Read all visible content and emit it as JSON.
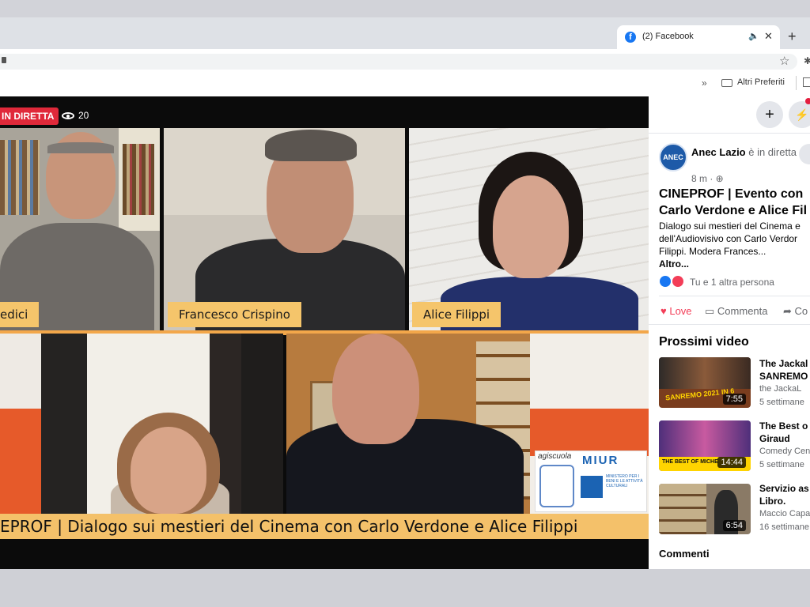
{
  "browser": {
    "tab_title": "(2) Facebook",
    "tab_icon": "facebook-icon",
    "bookmarks": {
      "chevron": "»",
      "folder_label": "Altri Preferiti"
    }
  },
  "video": {
    "live_label": "IN DIRETTA",
    "viewers": "20",
    "participants": [
      {
        "name": "edici"
      },
      {
        "name": "Francesco Crispino"
      },
      {
        "name": "Alice Filippi"
      }
    ],
    "caption": "EPROF | Dialogo sui mestieri del Cinema con Carlo Verdone e Alice Filippi",
    "logo_text": "agiscuola",
    "miur_text": "MIUR",
    "ministry_text": "MINISTERO PER I BENI E LE ATTIVITÀ CULTURALI"
  },
  "sidebar": {
    "add_icon": "+",
    "post": {
      "page_name": "Anec Lazio",
      "status": " è in diretta ora.",
      "time": "8 m · ",
      "logo_text": "ANEC",
      "title_line1": "CINEPROF | Evento con",
      "title_line2": "Carlo Verdone e Alice Fil",
      "desc_line1": "Dialogo sui mestieri del Cinema e",
      "desc_line2": "dell'Audiovisivo con Carlo Verdor",
      "desc_line3": "Filippi. Modera Frances...",
      "more": "Altro...",
      "reactions": "Tu e 1 altra persona",
      "love_label": "Love",
      "comment_label": "Commenta",
      "share_label": "Co"
    },
    "next_videos_title": "Prossimi video",
    "videos": [
      {
        "title1": "The Jackal",
        "title2": "SANREMO",
        "channel": "the JackaL",
        "age": "5 settimane",
        "duration": "7:55",
        "thumb_text": "SANREMO 2021 IN 6"
      },
      {
        "title1": "The Best o",
        "title2": "Giraud",
        "channel": "Comedy Cen",
        "age": "5 settimane",
        "duration": "14:44",
        "thumb_text": "THE BEST OF MICHE"
      },
      {
        "title1": "Servizio as",
        "title2": "Libro.",
        "channel": "Maccio Capa",
        "age": "16 settimane",
        "duration": "6:54",
        "thumb_text": ""
      }
    ],
    "comments_title": "Commenti"
  }
}
